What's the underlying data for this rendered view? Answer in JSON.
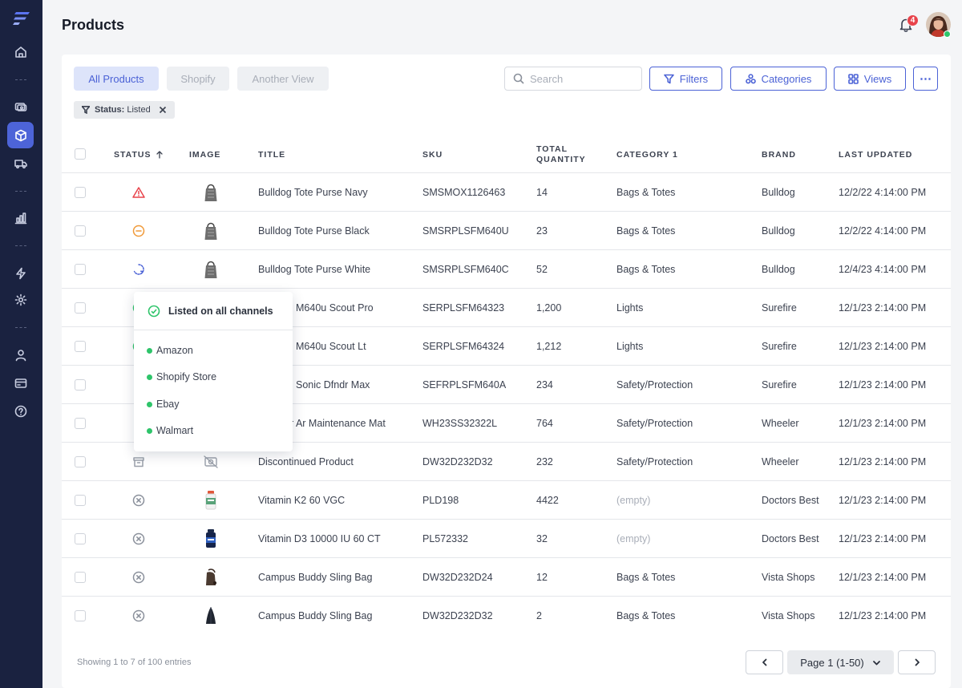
{
  "header": {
    "title": "Products",
    "notification_count": "4"
  },
  "views": [
    {
      "label": "All Products",
      "active": true
    },
    {
      "label": "Shopify",
      "active": false
    },
    {
      "label": "Another View",
      "active": false
    }
  ],
  "search": {
    "placeholder": "Search",
    "value": ""
  },
  "toolbar": {
    "filters_label": "Filters",
    "categories_label": "Categories",
    "views_label": "Views",
    "more_label": "⋯"
  },
  "filter_chip": {
    "key": "Status:",
    "value": "Listed"
  },
  "table": {
    "columns": {
      "status": "STATUS",
      "image": "IMAGE",
      "title": "TITLE",
      "sku": "SKU",
      "total_qty_line1": "TOTAL",
      "total_qty_line2": "QUANTITY",
      "category": "CATEGORY 1",
      "brand": "BRAND",
      "updated": "LAST UPDATED"
    },
    "rows": [
      {
        "title": "Bulldog Tote Purse Navy",
        "sku": "SMSMOX1126463",
        "qty": "14",
        "category": "Bags & Totes",
        "brand": "Bulldog",
        "updated": "12/2/22 4:14:00 PM"
      },
      {
        "title": "Bulldog Tote Purse Black",
        "sku": "SMSRPLSFM640U",
        "qty": "23",
        "category": "Bags & Totes",
        "brand": "Bulldog",
        "updated": "12/2/22 4:14:00 PM"
      },
      {
        "title": "Bulldog Tote Purse White",
        "sku": "SMSRPLSFM640C",
        "qty": "52",
        "category": "Bags & Totes",
        "brand": "Bulldog",
        "updated": "12/4/23 4:14:00 PM"
      },
      {
        "title": "M640u Scout Pro",
        "sku": "SERPLSFM64323",
        "qty": "1,200",
        "category": "Lights",
        "brand": "Surefire",
        "updated": "12/1/23 2:14:00 PM"
      },
      {
        "title": "M640u Scout Lt",
        "sku": "SERPLSFM64324",
        "qty": "1,212",
        "category": "Lights",
        "brand": "Surefire",
        "updated": "12/1/23 2:14:00 PM"
      },
      {
        "title": "Sonic Dfndr Max",
        "sku": "SEFRPLSFM640A",
        "qty": "234",
        "category": "Safety/Protection",
        "brand": "Surefire",
        "updated": "12/1/23 2:14:00 PM"
      },
      {
        "title": "r Ar Maintenance Mat",
        "sku": "WH23SS32322L",
        "qty": "764",
        "category": "Safety/Protection",
        "brand": "Wheeler",
        "updated": "12/1/23 2:14:00 PM"
      },
      {
        "title": "Discontinued Product",
        "sku": "DW32D232D32",
        "qty": "232",
        "category": "Safety/Protection",
        "brand": "Wheeler",
        "updated": "12/1/23 2:14:00 PM"
      },
      {
        "title": "Vitamin K2 60 VGC",
        "sku": "PLD198",
        "qty": "4422",
        "category": "(empty)",
        "brand": "Doctors Best",
        "updated": "12/1/23 2:14:00 PM"
      },
      {
        "title": "Vitamin D3 10000 IU 60 CT",
        "sku": "PL572332",
        "qty": "32",
        "category": "(empty)",
        "brand": "Doctors Best",
        "updated": "12/1/23 2:14:00 PM"
      },
      {
        "title": "Campus Buddy Sling Bag",
        "sku": "DW32D232D24",
        "qty": "12",
        "category": "Bags & Totes",
        "brand": "Vista Shops",
        "updated": "12/1/23 2:14:00 PM"
      },
      {
        "title": "Campus Buddy Sling Bag",
        "sku": "DW32D232D32",
        "qty": "2",
        "category": "Bags & Totes",
        "brand": "Vista Shops",
        "updated": "12/1/23 2:14:00 PM"
      }
    ]
  },
  "popover": {
    "title": "Listed on all channels",
    "channels": [
      "Amazon",
      "Shopify Store",
      "Ebay",
      "Walmart"
    ]
  },
  "footer": {
    "entries": "Showing 1 to 7 of 100 entries",
    "page_label": "Page 1 (1-50)"
  },
  "colors": {
    "accent": "#4b62d6",
    "sidebar": "#1a2240",
    "success": "#2ec46a",
    "danger": "#e8434b",
    "warning": "#f09a3a"
  }
}
